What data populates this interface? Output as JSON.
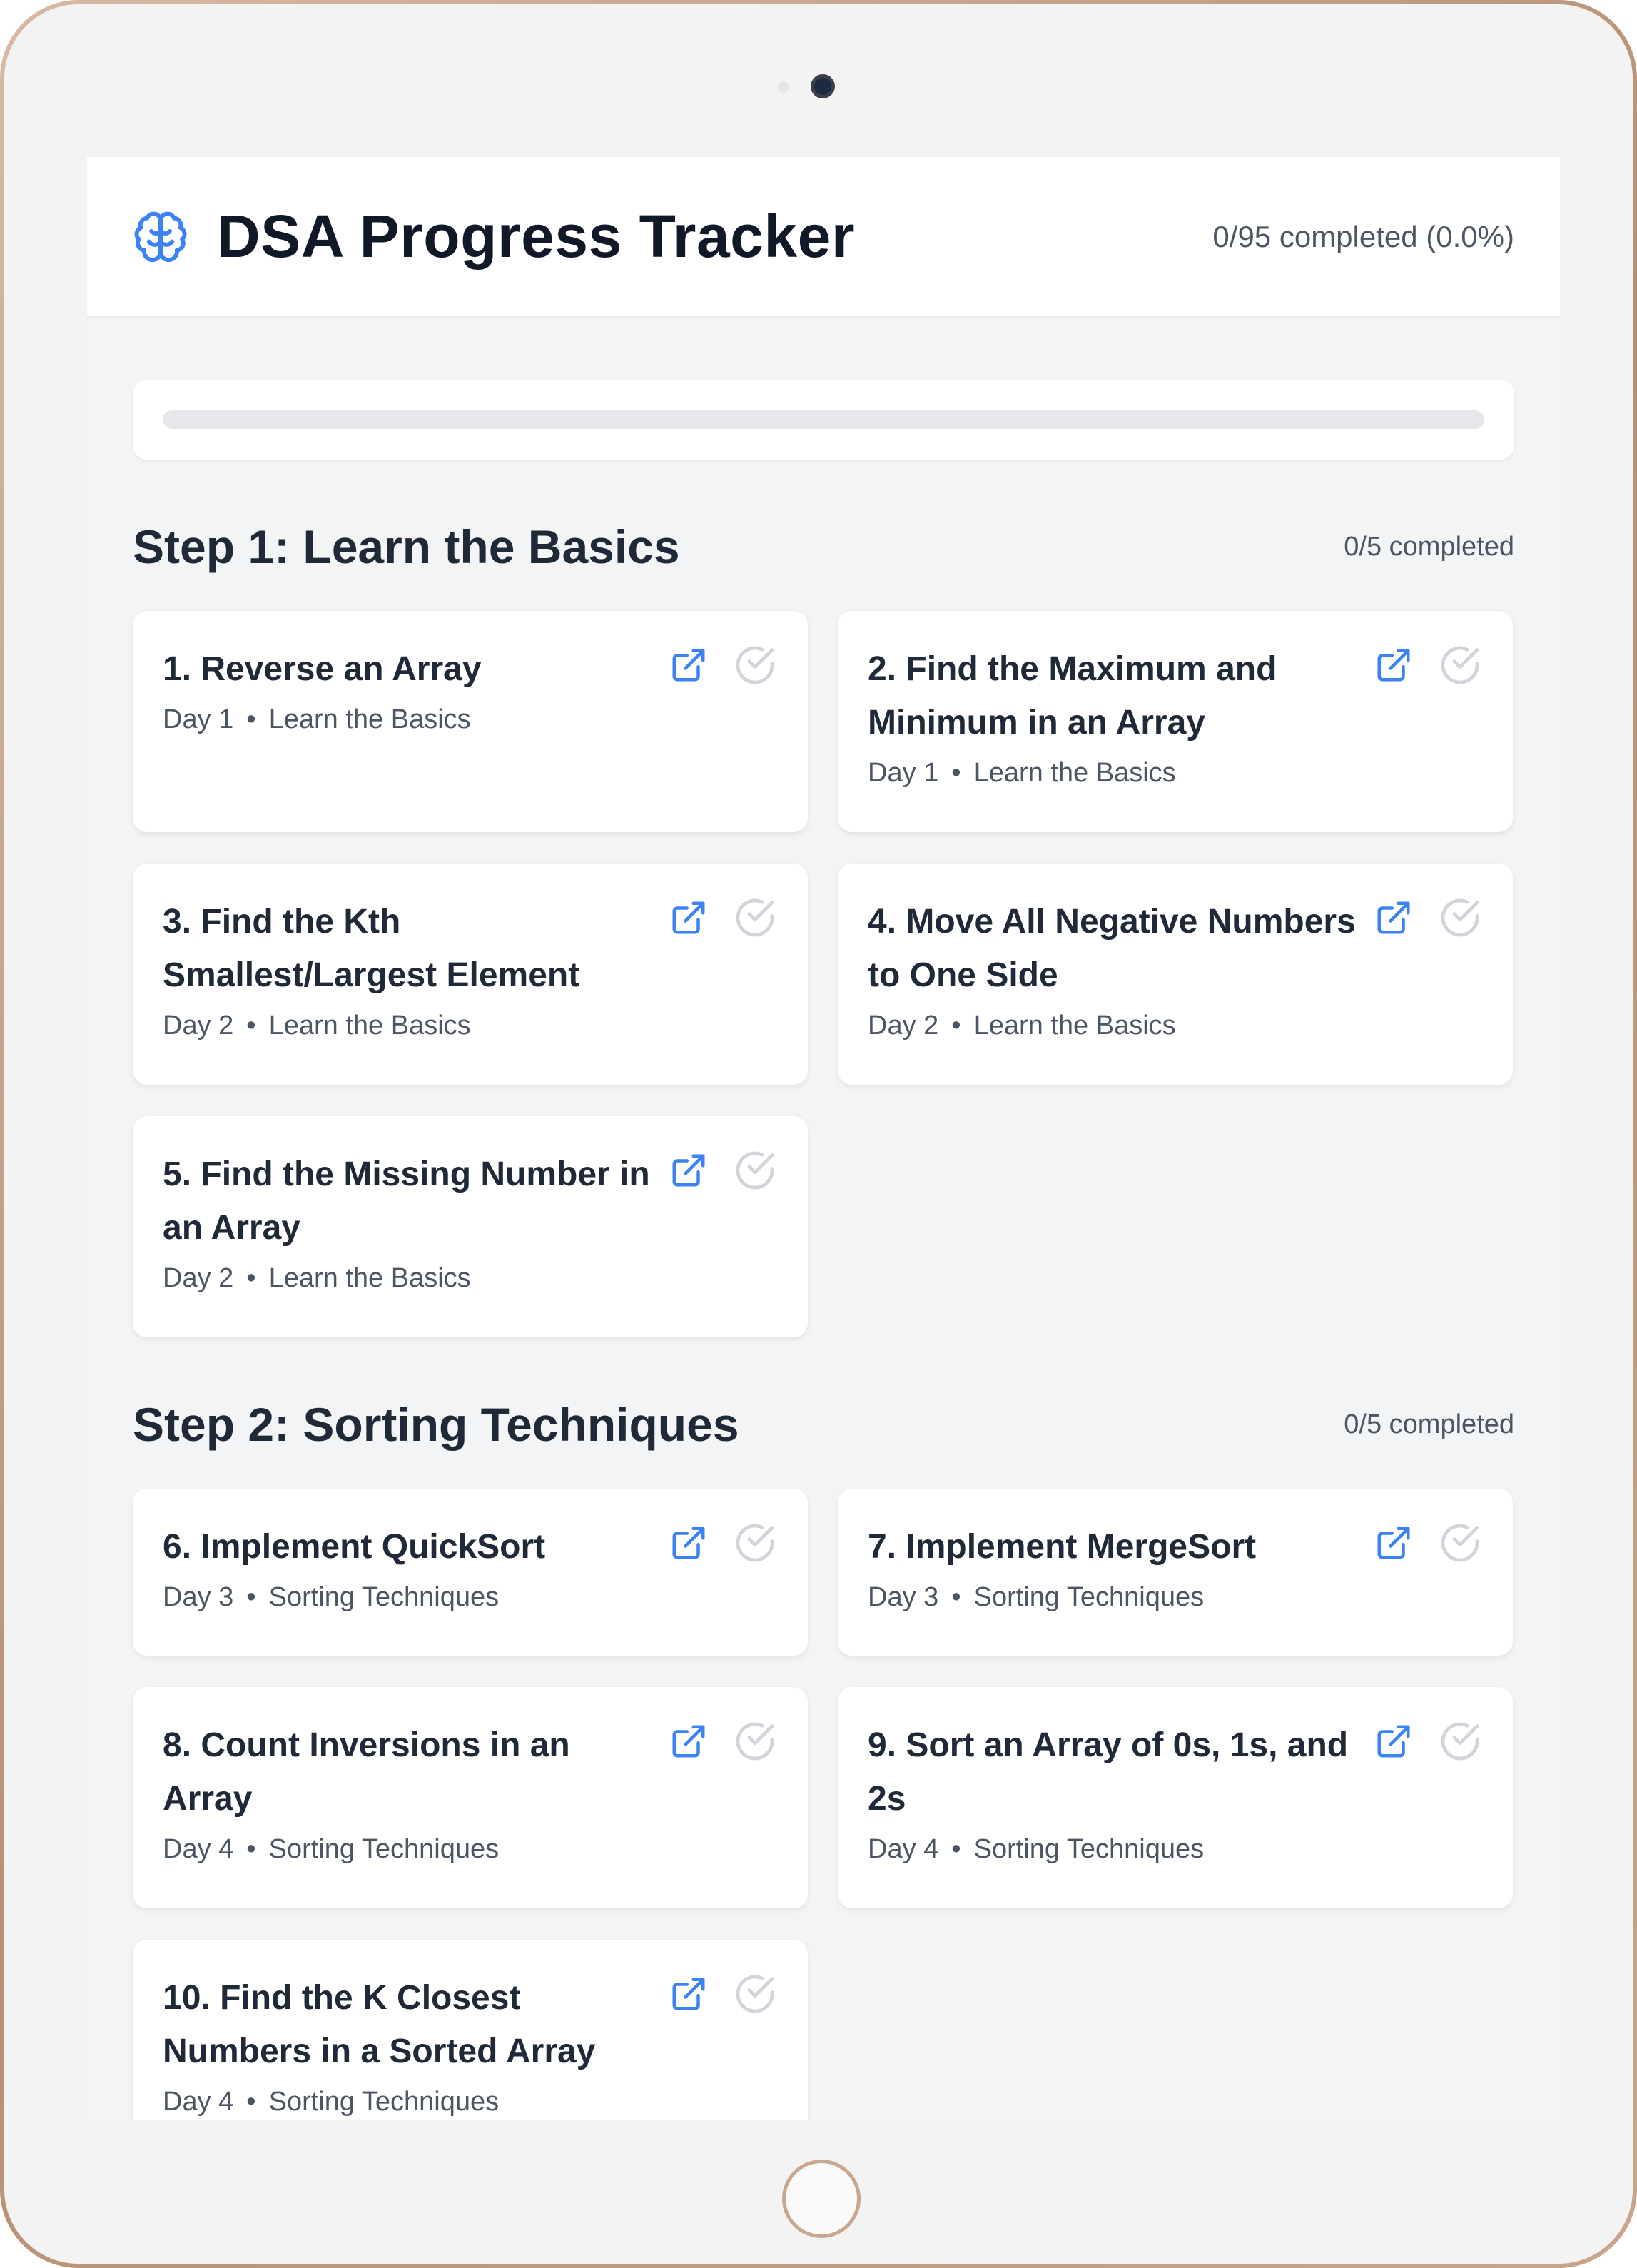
{
  "header": {
    "title": "DSA Progress Tracker",
    "overall_progress": "0/95 completed (0.0%)",
    "progress_fraction": 0.0
  },
  "sections": [
    {
      "title": "Step 1: Learn the Basics",
      "count": "0/5 completed",
      "problems": [
        {
          "title": "1. Reverse an Array",
          "day": "Day 1",
          "topic": "Learn the Basics"
        },
        {
          "title": "2. Find the Maximum and Minimum in an Array",
          "day": "Day 1",
          "topic": "Learn the Basics"
        },
        {
          "title": "3. Find the Kth Smallest/Largest Element",
          "day": "Day 2",
          "topic": "Learn the Basics"
        },
        {
          "title": "4. Move All Negative Numbers to One Side",
          "day": "Day 2",
          "topic": "Learn the Basics"
        },
        {
          "title": "5. Find the Missing Number in an Array",
          "day": "Day 2",
          "topic": "Learn the Basics"
        }
      ]
    },
    {
      "title": "Step 2: Sorting Techniques",
      "count": "0/5 completed",
      "problems": [
        {
          "title": "6. Implement QuickSort",
          "day": "Day 3",
          "topic": "Sorting Techniques"
        },
        {
          "title": "7. Implement MergeSort",
          "day": "Day 3",
          "topic": "Sorting Techniques"
        },
        {
          "title": "8. Count Inversions in an Array",
          "day": "Day 4",
          "topic": "Sorting Techniques"
        },
        {
          "title": "9. Sort an Array of 0s, 1s, and 2s",
          "day": "Day 4",
          "topic": "Sorting Techniques"
        },
        {
          "title": "10. Find the K Closest Numbers in a Sorted Array",
          "day": "Day 4",
          "topic": "Sorting Techniques"
        }
      ]
    }
  ],
  "icons": {
    "brand": "brain-icon",
    "link": "external-link-icon",
    "status": "check-circle-icon"
  },
  "colors": {
    "accent": "#3b82f6",
    "check_inactive": "#d1d5db"
  }
}
